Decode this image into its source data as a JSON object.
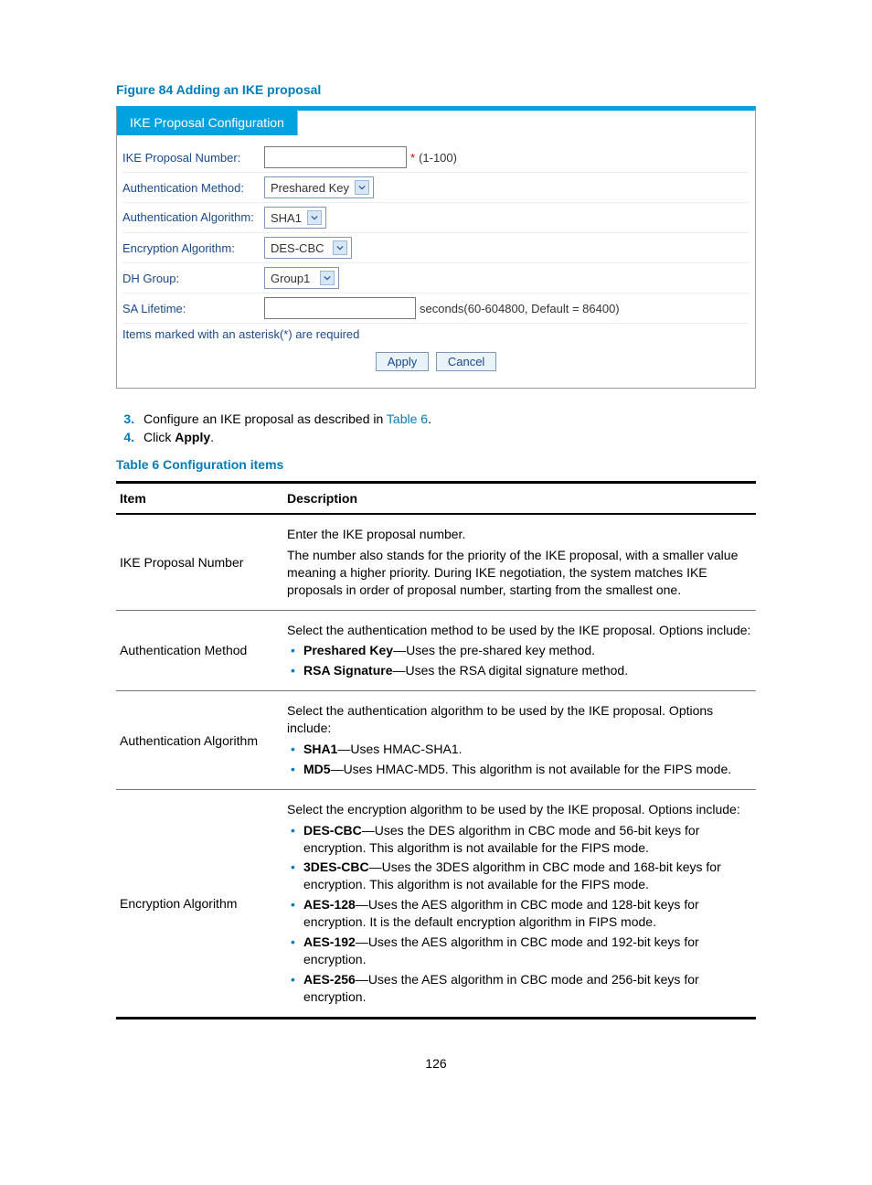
{
  "figure_title": "Figure 84 Adding an IKE proposal",
  "panel": {
    "tab": "IKE Proposal Configuration",
    "rows": {
      "proposal_number_label": "IKE Proposal Number:",
      "proposal_number_hint": "(1-100)",
      "auth_method_label": "Authentication Method:",
      "auth_method_value": "Preshared Key",
      "auth_algo_label": "Authentication Algorithm:",
      "auth_algo_value": "SHA1",
      "enc_algo_label": "Encryption Algorithm:",
      "enc_algo_value": "DES-CBC",
      "dh_label": "DH Group:",
      "dh_value": "Group1",
      "sa_label": "SA Lifetime:",
      "sa_hint": "seconds(60-604800, Default = 86400)"
    },
    "note": "Items marked with an asterisk(*) are required",
    "apply": "Apply",
    "cancel": "Cancel"
  },
  "steps": {
    "s3a": "Configure an IKE proposal as described in ",
    "s3link": "Table 6",
    "s3b": ".",
    "s4a": "Click ",
    "s4b": "Apply",
    "s4c": "."
  },
  "table_title": "Table 6 Configuration items",
  "table_headers": {
    "item": "Item",
    "desc": "Description"
  },
  "tr1": {
    "item": "IKE Proposal Number",
    "p1": "Enter the IKE proposal number.",
    "p2": "The number also stands for the priority of the IKE proposal, with a smaller value meaning a higher priority. During IKE negotiation, the system matches IKE proposals in order of proposal number, starting from the smallest one."
  },
  "tr2": {
    "item": "Authentication Method",
    "p1": "Select the authentication method to be used by the IKE proposal. Options include:",
    "b1a": "Preshared Key",
    "b1b": "—Uses the pre-shared key method.",
    "b2a": "RSA Signature",
    "b2b": "—Uses the RSA digital signature method."
  },
  "tr3": {
    "item": "Authentication Algorithm",
    "p1": "Select the authentication algorithm to be used by the IKE proposal. Options include:",
    "b1a": "SHA1",
    "b1b": "—Uses HMAC-SHA1.",
    "b2a": "MD5",
    "b2b": "—Uses HMAC-MD5. This algorithm is not available for the FIPS mode."
  },
  "tr4": {
    "item": "Encryption Algorithm",
    "p1": "Select the encryption algorithm to be used by the IKE proposal. Options include:",
    "b1a": "DES-CBC",
    "b1b": "—Uses the DES algorithm in CBC mode and 56-bit keys for encryption. This algorithm is not available for the FIPS mode.",
    "b2a": "3DES-CBC",
    "b2b": "—Uses the 3DES algorithm in CBC mode and 168-bit keys for encryption. This algorithm is not available for the FIPS mode.",
    "b3a": "AES-128",
    "b3b": "—Uses the AES algorithm in CBC mode and 128-bit keys for encryption. It is the default encryption algorithm in FIPS mode.",
    "b4a": "AES-192",
    "b4b": "—Uses the AES algorithm in CBC mode and 192-bit keys for encryption.",
    "b5a": "AES-256",
    "b5b": "—Uses the AES algorithm in CBC mode and 256-bit keys for encryption."
  },
  "page_number": "126"
}
